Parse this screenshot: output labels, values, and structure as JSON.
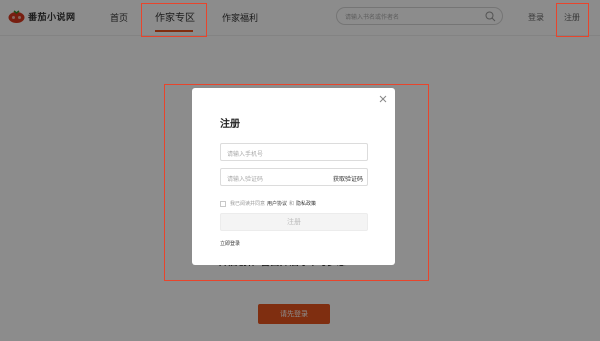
{
  "header": {
    "logo_text": "番茄小说网",
    "nav": [
      {
        "label": "首页"
      },
      {
        "label": "作家专区"
      },
      {
        "label": "作家福利"
      }
    ],
    "search_placeholder": "请输入书名或作者名",
    "login_label": "登录",
    "register_label": "注册"
  },
  "page": {
    "background_text": "开启创作·自由挥洒才华与梦想",
    "login_first_button": "请先登录"
  },
  "modal": {
    "title": "注册",
    "phone_placeholder": "请输入手机号",
    "code_placeholder": "请输入验证码",
    "get_code_label": "获取验证码",
    "agree_prefix": "我已阅读并同意",
    "user_agreement": "用户协议",
    "and_text": "和",
    "privacy_policy": "隐私政策",
    "submit_label": "注册",
    "login_now": "立即登录"
  },
  "colors": {
    "accent": "#e8541e",
    "annotation": "#e8452c"
  }
}
